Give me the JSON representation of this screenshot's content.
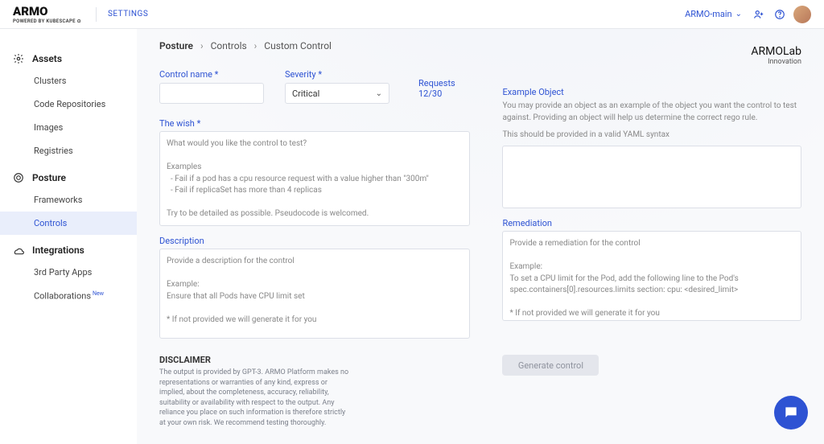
{
  "header": {
    "logo": "ARMO",
    "logoSub": "POWERED BY KUBESCAPE ⊙",
    "settings": "SETTINGS",
    "tenant": "ARMO-main"
  },
  "sidebar": {
    "assets": {
      "label": "Assets",
      "items": [
        "Clusters",
        "Code Repositories",
        "Images",
        "Registries"
      ]
    },
    "posture": {
      "label": "Posture",
      "items": [
        "Frameworks",
        "Controls"
      ],
      "activeIndex": 1
    },
    "integrations": {
      "label": "Integrations",
      "items": [
        "3rd Party Apps",
        "Collaborations"
      ],
      "newBadgeIndex": 1
    }
  },
  "breadcrumb": {
    "a": "Posture",
    "b": "Controls",
    "c": "Custom Control"
  },
  "form": {
    "controlNameLabel": "Control name *",
    "severityLabel": "Severity *",
    "severityValue": "Critical",
    "requests": "Requests  12/30",
    "wishLabel": "The wish *",
    "wishPlaceholder": "What would you like the control to test?\n\nExamples\n  - Fail if a pod has a cpu resource request with a value higher than \"300m\"\n  - Fail if replicaSet has more than 4 replicas\n\nTry to be detailed as possible. Pseudocode is welcomed.",
    "descLabel": "Description",
    "descPlaceholder": "Provide a description for the control\n\nExample:\nEnsure that all Pods have CPU limit set\n\n* If not provided we will generate it for you",
    "exLabel": "Example Object",
    "exHint1": "You may provide an object as an example of the object you want the control to test against. Providing an object will help us determine the correct rego rule.",
    "exHint2": "This should be provided in a valid YAML syntax",
    "remLabel": "Remediation",
    "remPlaceholder": "Provide a remediation for the control\n\nExample:\nTo set a CPU limit for the Pod, add the following line to the Pod's spec.containers[0].resources.limits section: cpu: <desired_limit>\n\n* If not provided we will generate it for you"
  },
  "armolab": {
    "line1a": "ARMO",
    "line1b": "Lab",
    "line2": "Innovation"
  },
  "disclaimer": {
    "title": "DISCLAIMER",
    "body": "The output is provided by GPT-3. ARMO Platform makes no representations or warranties of any kind, express or implied, about the completeness, accuracy, reliability, suitability or availability with respect to the output. Any reliance you place on such information is therefore strictly at your own risk. We recommend testing thoroughly."
  },
  "generateLabel": "Generate control",
  "newBadge": "New"
}
